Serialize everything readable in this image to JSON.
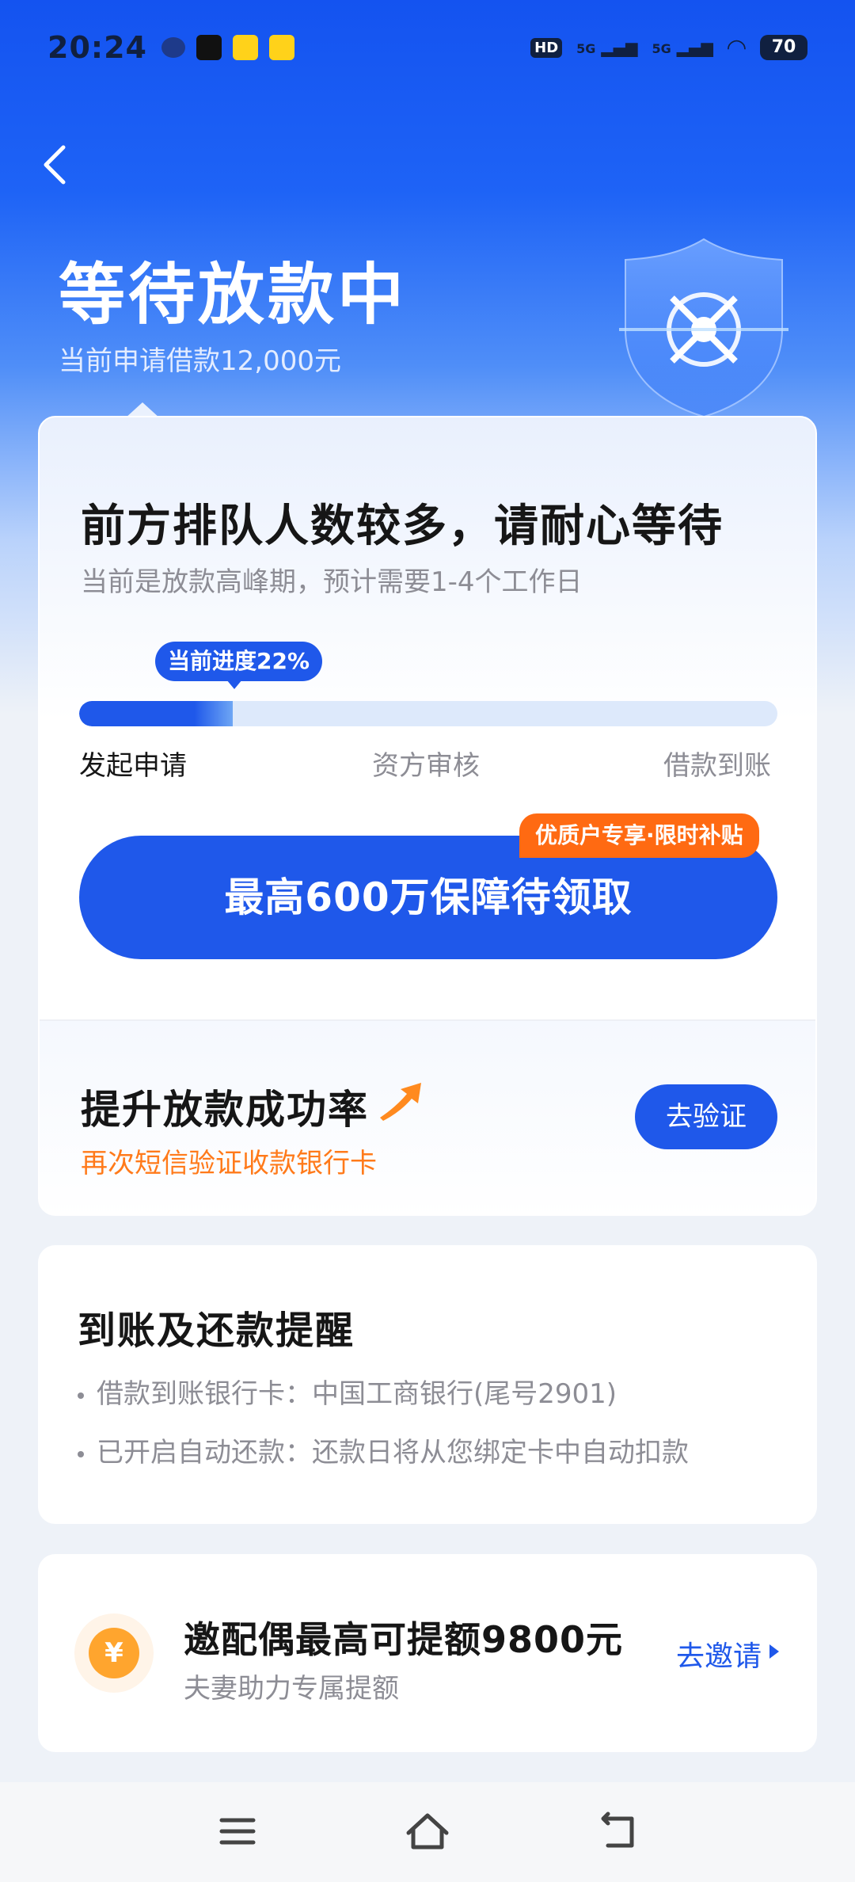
{
  "status_bar": {
    "time": "20:24",
    "signal_1": "5G",
    "signal_2": "5G",
    "hd_label": "HD",
    "battery": "70"
  },
  "header": {
    "title": "等待放款中",
    "subtitle": "当前申请借款12,000元"
  },
  "progress_card": {
    "title": "前方排队人数较多，请耐心等待",
    "subtitle": "当前是放款高峰期，预计需要1-4个工作日",
    "tip": "当前进度22%",
    "progress": 0.22,
    "steps": [
      "发起申请",
      "资方审核",
      "借款到账"
    ],
    "cta_tag": "优质户专享·限时补贴",
    "cta_label": "最高600万保障待领取"
  },
  "verify": {
    "title": "提升放款成功率",
    "subtitle": "再次短信验证收款银行卡",
    "button": "去验证"
  },
  "reminder": {
    "title": "到账及还款提醒",
    "items": [
      "借款到账银行卡：中国工商银行(尾号2901)",
      "已开启自动还款：还款日将从您绑定卡中自动扣款"
    ]
  },
  "invite": {
    "coin": "¥",
    "title": "邀配偶最高可提额9800元",
    "subtitle": "夫妻助力专属提额",
    "link": "去邀请"
  },
  "colors": {
    "primary": "#1f58ea",
    "accent_orange": "#ff6a12",
    "text_gray": "#8d8d95"
  }
}
